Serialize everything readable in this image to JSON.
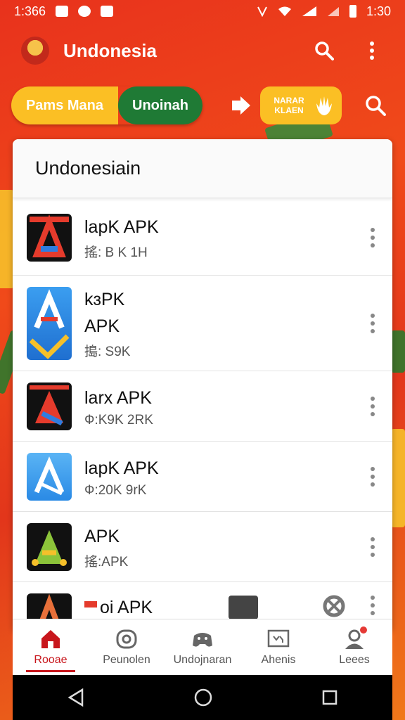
{
  "status_bar": {
    "time_left": "1:366",
    "time_right": "1:30"
  },
  "app_bar": {
    "title": "Undonesia"
  },
  "toggle": {
    "option_off": "Pams Mana",
    "option_on": "Unoinah"
  },
  "promo": {
    "line1": "NARAR",
    "line2": "KLAEN"
  },
  "card": {
    "header": "Undonesiain"
  },
  "apps": [
    {
      "name": "lapK APK",
      "sub": "搖: B K 1H",
      "icon": "app-icon-a-dark"
    },
    {
      "name": "kɜPK\nAPK",
      "sub": "搗: S9K",
      "icon": "app-icon-a-blue"
    },
    {
      "name": "larx APK",
      "sub": "Ф:K9K 2RK",
      "icon": "app-icon-a-red"
    },
    {
      "name": "lapK APK",
      "sub": "Ф:20K 9rK",
      "icon": "app-icon-a-lightblue"
    },
    {
      "name": "APK",
      "sub": "搖:APK",
      "icon": "app-icon-a-green"
    },
    {
      "name": "oi APK",
      "sub": "",
      "icon": "app-icon-a-partial"
    }
  ],
  "bottom_nav": [
    {
      "label": "Rooae",
      "icon": "home-icon",
      "active": true
    },
    {
      "label": "Peunolen",
      "icon": "games-icon",
      "active": false
    },
    {
      "label": "Undojnaran",
      "icon": "controller-icon",
      "active": false
    },
    {
      "label": "Ahenis",
      "icon": "apps-window-icon",
      "active": false
    },
    {
      "label": "Leees",
      "icon": "profile-icon",
      "active": false
    }
  ],
  "colors": {
    "primary": "#e8321c",
    "toggle_off": "#fbbf24",
    "toggle_on": "#1f7a35",
    "active_nav": "#c8161c"
  }
}
